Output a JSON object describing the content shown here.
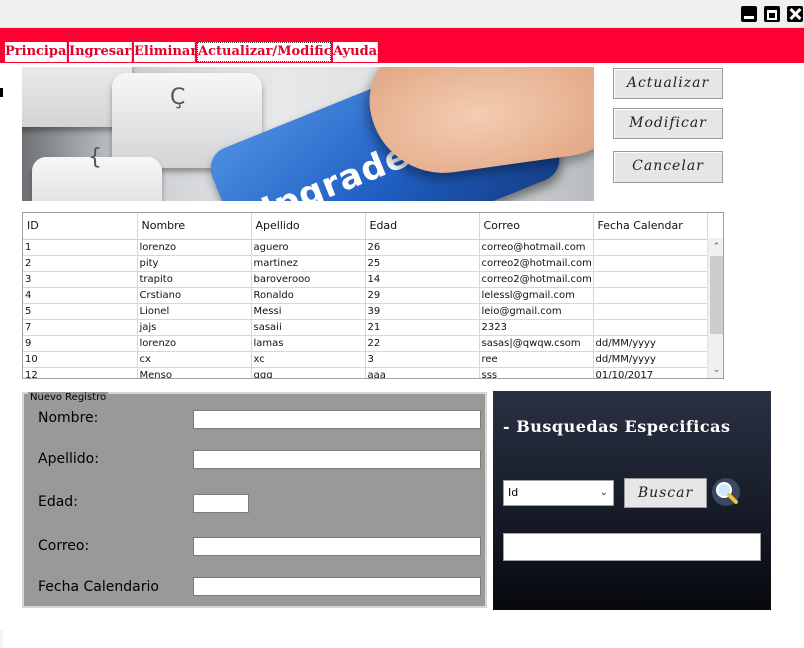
{
  "menu": {
    "items": [
      {
        "label": "Principal"
      },
      {
        "label": "Ingresar"
      },
      {
        "label": "Eliminar"
      },
      {
        "label": "Actualizar/Modificar"
      },
      {
        "label": "Ayuda"
      }
    ],
    "active": "Actualizar/Modificar"
  },
  "banner": {
    "key_text": "Upgrade"
  },
  "actions": {
    "actualizar": "Actualizar",
    "modificar": "Modificar",
    "cancelar": "Cancelar"
  },
  "grid": {
    "columns": [
      "ID",
      "Nombre",
      "Apellido",
      "Edad",
      "Correo",
      "Fecha Calendar"
    ],
    "rows": [
      [
        "1",
        "lorenzo",
        "aguero",
        "26",
        "correo@hotmail.com",
        ""
      ],
      [
        "2",
        "pity",
        "martinez",
        "25",
        "correo2@hotmail.com",
        ""
      ],
      [
        "3",
        "trapito",
        "baroverooo",
        "14",
        "correo2@hotmail.com",
        ""
      ],
      [
        "4",
        "Crstiano",
        "Ronaldo",
        "29",
        "lelessl@gmail.com",
        ""
      ],
      [
        "5",
        "Lionel",
        "Messi",
        "39",
        "leio@gmail.com",
        ""
      ],
      [
        "7",
        "jajs",
        "sasaii",
        "21",
        "2323",
        ""
      ],
      [
        "9",
        "lorenzo",
        "lamas",
        "22",
        "sasas|@qwqw.csom",
        "dd/MM/yyyy"
      ],
      [
        "10",
        " cx",
        "xc",
        "3",
        "ree",
        "dd/MM/yyyy"
      ],
      [
        "12",
        "Menso",
        "qqq",
        "aaa",
        "sss",
        "01/10/2017"
      ]
    ]
  },
  "form": {
    "group_title": "Nuevo Registro",
    "nombre_label": "Nombre:",
    "apellido_label": "Apellido:",
    "edad_label": "Edad:",
    "correo_label": "Correo:",
    "fecha_label": "Fecha Calendario"
  },
  "search": {
    "title": "- Busquedas Especificas",
    "selected": "Id",
    "button": "Buscar"
  },
  "colors": {
    "menu_bar": "#ff0033",
    "form_bg": "#999999",
    "panel_bg": "#161b27"
  }
}
